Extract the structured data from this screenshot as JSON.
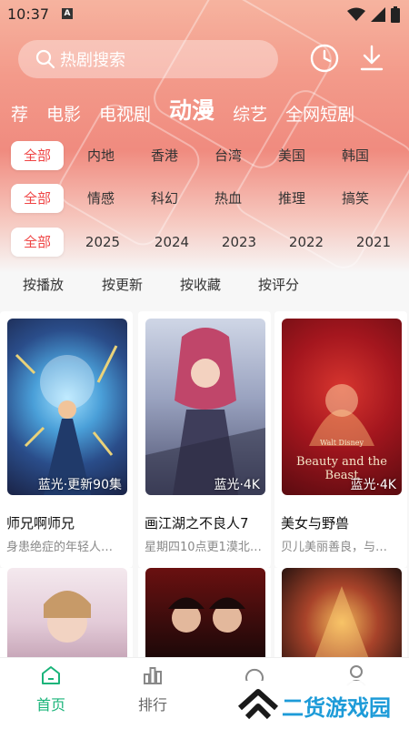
{
  "status": {
    "time": "10:37",
    "keyboard_badge": "A"
  },
  "search": {
    "placeholder": "热剧搜索"
  },
  "nav_tabs": [
    "荐",
    "电影",
    "电视剧",
    "动漫",
    "综艺",
    "全网短剧"
  ],
  "active_tab": "动漫",
  "filters": {
    "region": [
      "全部",
      "内地",
      "香港",
      "台湾",
      "美国",
      "韩国"
    ],
    "genre": [
      "全部",
      "情感",
      "科幻",
      "热血",
      "推理",
      "搞笑"
    ],
    "year": [
      "全部",
      "2025",
      "2024",
      "2023",
      "2022",
      "2021"
    ]
  },
  "sort": [
    "按播放",
    "按更新",
    "按收藏",
    "按评分"
  ],
  "cards": [
    {
      "title": "师兄啊师兄",
      "desc": "身患绝症的年轻人…",
      "badge": "蓝光·更新90集"
    },
    {
      "title": "画江湖之不良人7",
      "desc": "星期四10点更1漠北…",
      "badge": "蓝光·4K"
    },
    {
      "title": "美女与野兽",
      "desc": "贝儿美丽善良，与…",
      "badge": "蓝光·4K"
    }
  ],
  "posters": {
    "beauty_brand": "Walt Disney",
    "beauty_title": "Beauty and the Beast"
  },
  "bottom_nav": [
    {
      "label": "首页",
      "active": true
    },
    {
      "label": "排行",
      "active": false
    },
    {
      "label": "",
      "active": false
    },
    {
      "label": "",
      "active": false
    }
  ],
  "watermark": {
    "text": "二货游戏园"
  },
  "colors": {
    "accent": "#ef4444",
    "active_nav": "#1ab47a",
    "watermark": "#1d9bd8"
  }
}
